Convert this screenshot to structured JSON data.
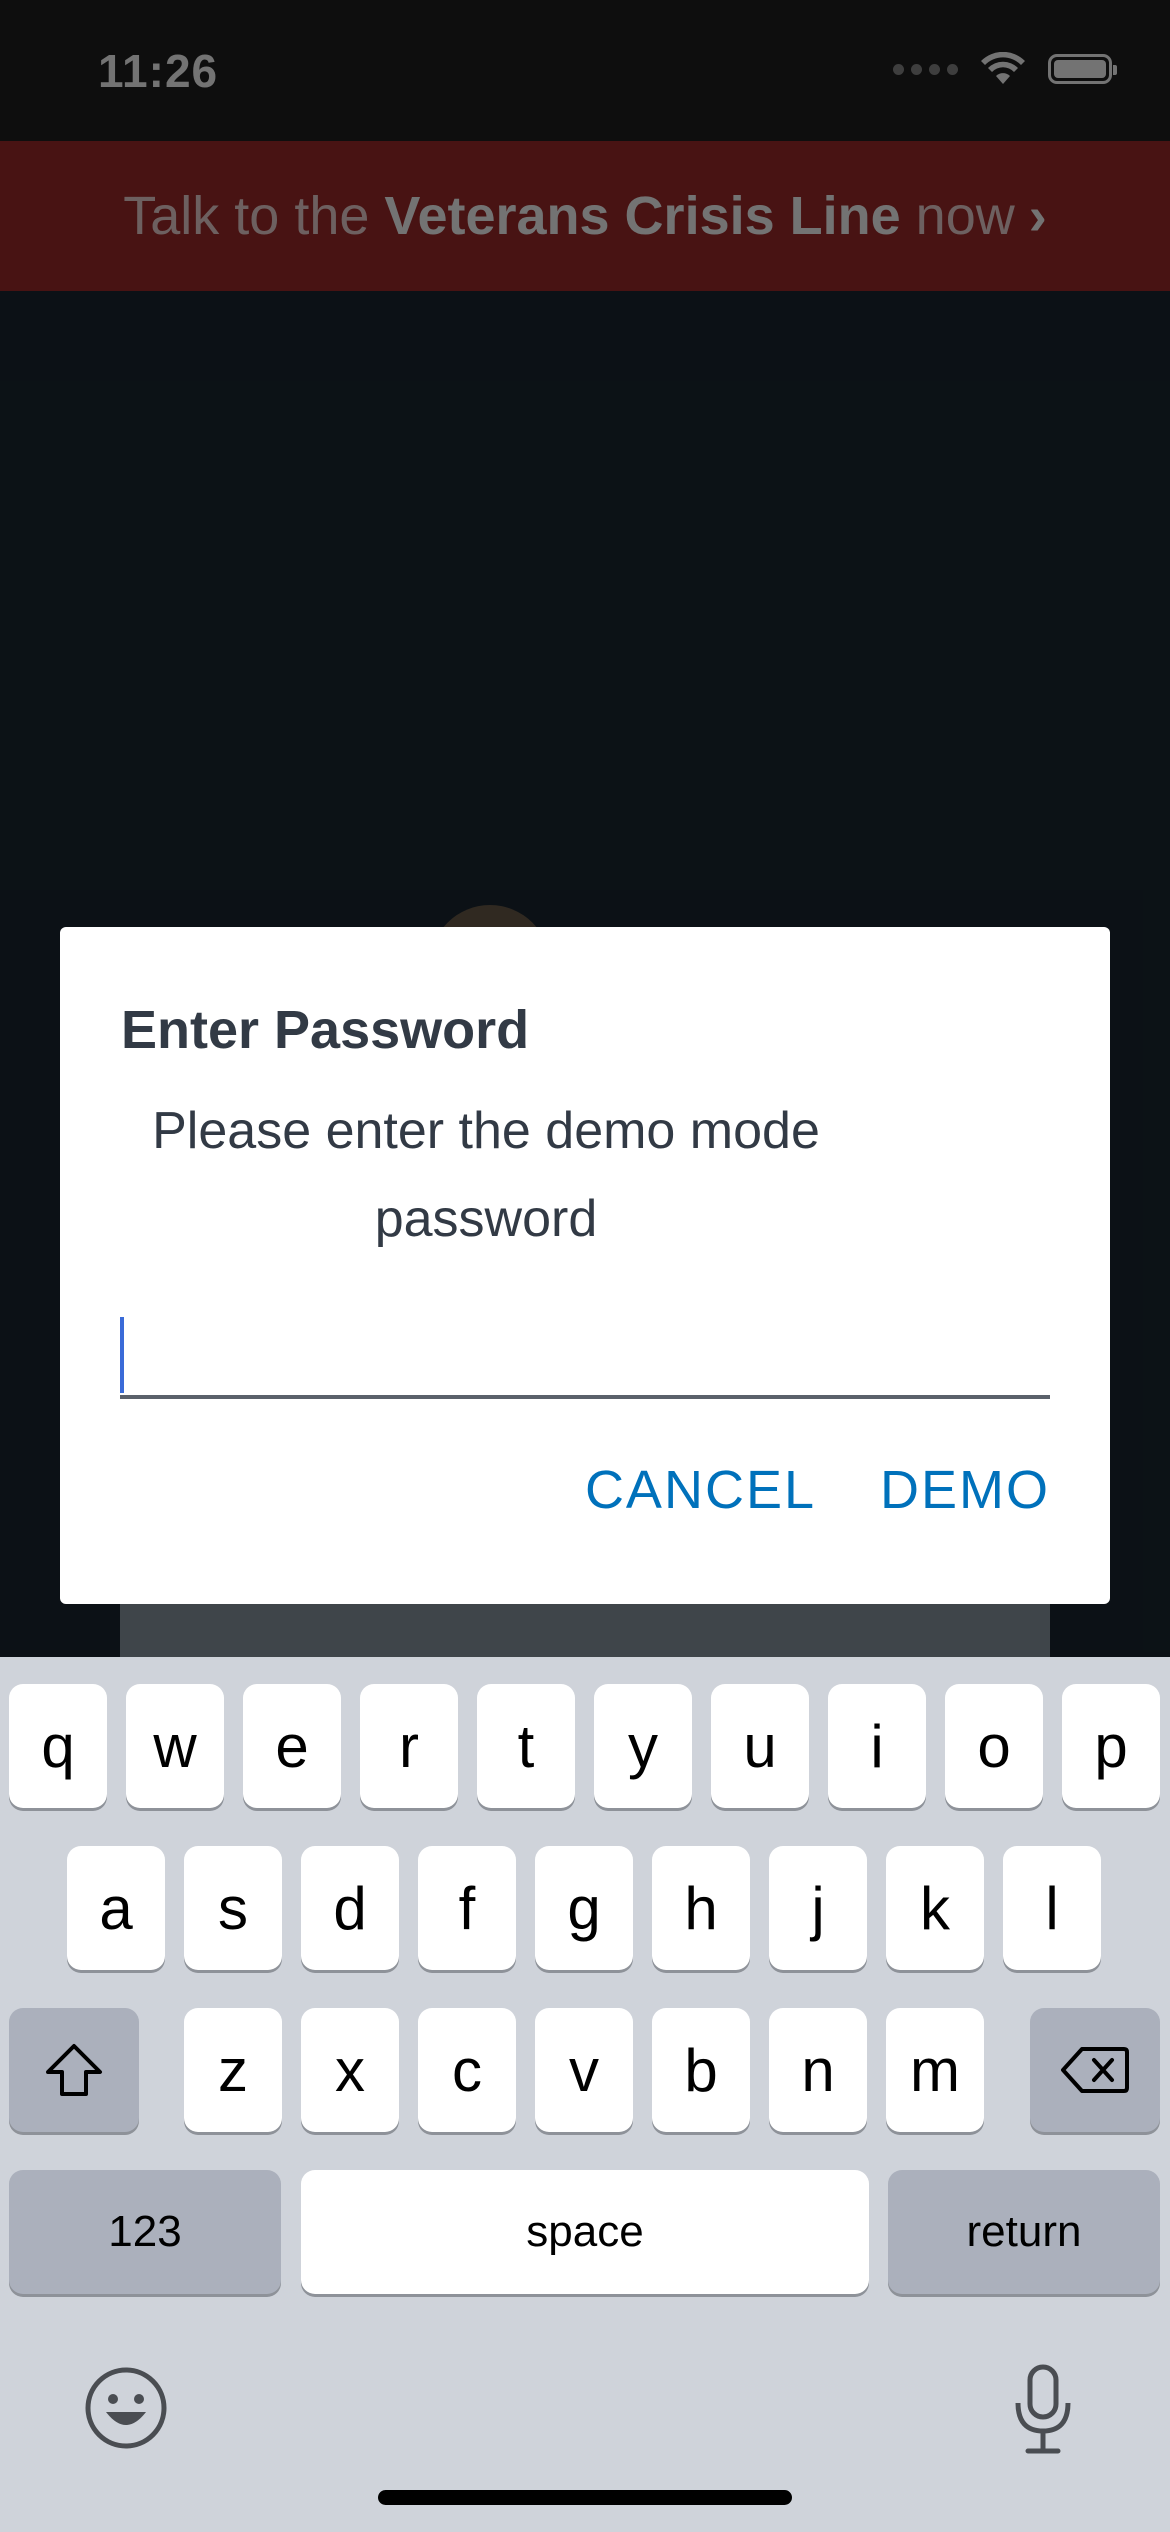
{
  "status_bar": {
    "time": "11:26"
  },
  "crisis_banner": {
    "prefix": "Talk to the ",
    "emphasis": "Veterans Crisis Line",
    "suffix": " now",
    "chevron": "›"
  },
  "dialog": {
    "title": "Enter Password",
    "message": "Please enter the demo mode password",
    "input_value": "",
    "cancel_label": "CANCEL",
    "demo_label": "DEMO"
  },
  "keyboard": {
    "row1": [
      "q",
      "w",
      "e",
      "r",
      "t",
      "y",
      "u",
      "i",
      "o",
      "p"
    ],
    "row2": [
      "a",
      "s",
      "d",
      "f",
      "g",
      "h",
      "j",
      "k",
      "l"
    ],
    "row3": [
      "z",
      "x",
      "c",
      "v",
      "b",
      "n",
      "m"
    ],
    "numbers_label": "123",
    "space_label": "space",
    "return_label": "return",
    "icons": {
      "shift": "shift-icon",
      "delete": "delete-icon",
      "emoji": "emoji-icon",
      "mic": "microphone-icon"
    }
  },
  "colors": {
    "banner": "#a12b2a",
    "accent": "#0071bb",
    "background": "#1b2731"
  }
}
